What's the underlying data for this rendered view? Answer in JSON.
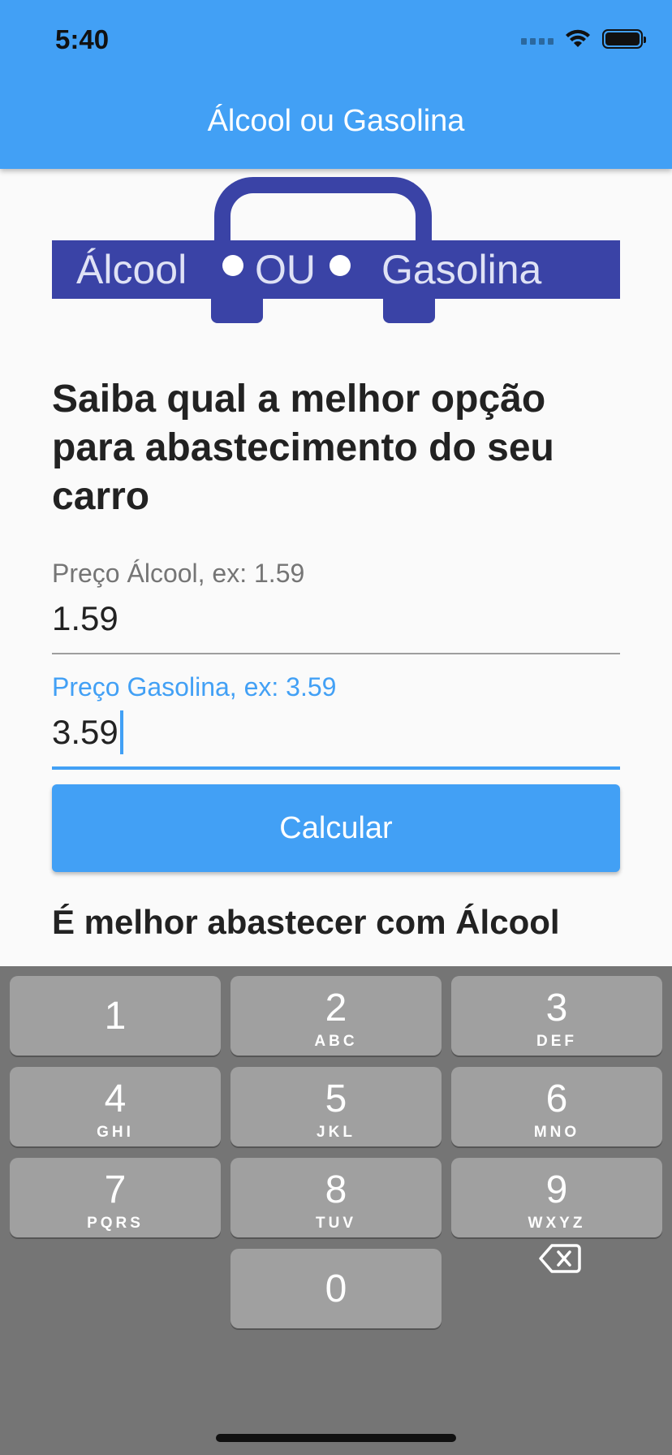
{
  "status_bar": {
    "time": "5:40"
  },
  "appbar": {
    "title": "Álcool ou Gasolina"
  },
  "logo": {
    "word_left": "Álcool",
    "word_middle": "OU",
    "word_right": "Gasolina"
  },
  "heading": "Saiba qual a melhor opção para abastecimento do seu carro",
  "fields": {
    "alcool": {
      "label": "Preço Álcool, ex: 1.59",
      "value": "1.59"
    },
    "gasolina": {
      "label": "Preço Gasolina, ex: 3.59",
      "value": "3.59"
    }
  },
  "button": {
    "label": "Calcular"
  },
  "result": "É melhor abastecer com Álcool",
  "keyboard": {
    "keys": [
      {
        "num": "1",
        "letters": ""
      },
      {
        "num": "2",
        "letters": "ABC"
      },
      {
        "num": "3",
        "letters": "DEF"
      },
      {
        "num": "4",
        "letters": "GHI"
      },
      {
        "num": "5",
        "letters": "JKL"
      },
      {
        "num": "6",
        "letters": "MNO"
      },
      {
        "num": "7",
        "letters": "PQRS"
      },
      {
        "num": "8",
        "letters": "TUV"
      },
      {
        "num": "9",
        "letters": "WXYZ"
      },
      {
        "num": "0",
        "letters": ""
      }
    ],
    "delete_icon": "backspace-icon"
  },
  "colors": {
    "primary": "#42a0f5",
    "logo": "#3a43a6",
    "keyboard_bg": "#757575",
    "key_bg": "#a0a0a0"
  }
}
